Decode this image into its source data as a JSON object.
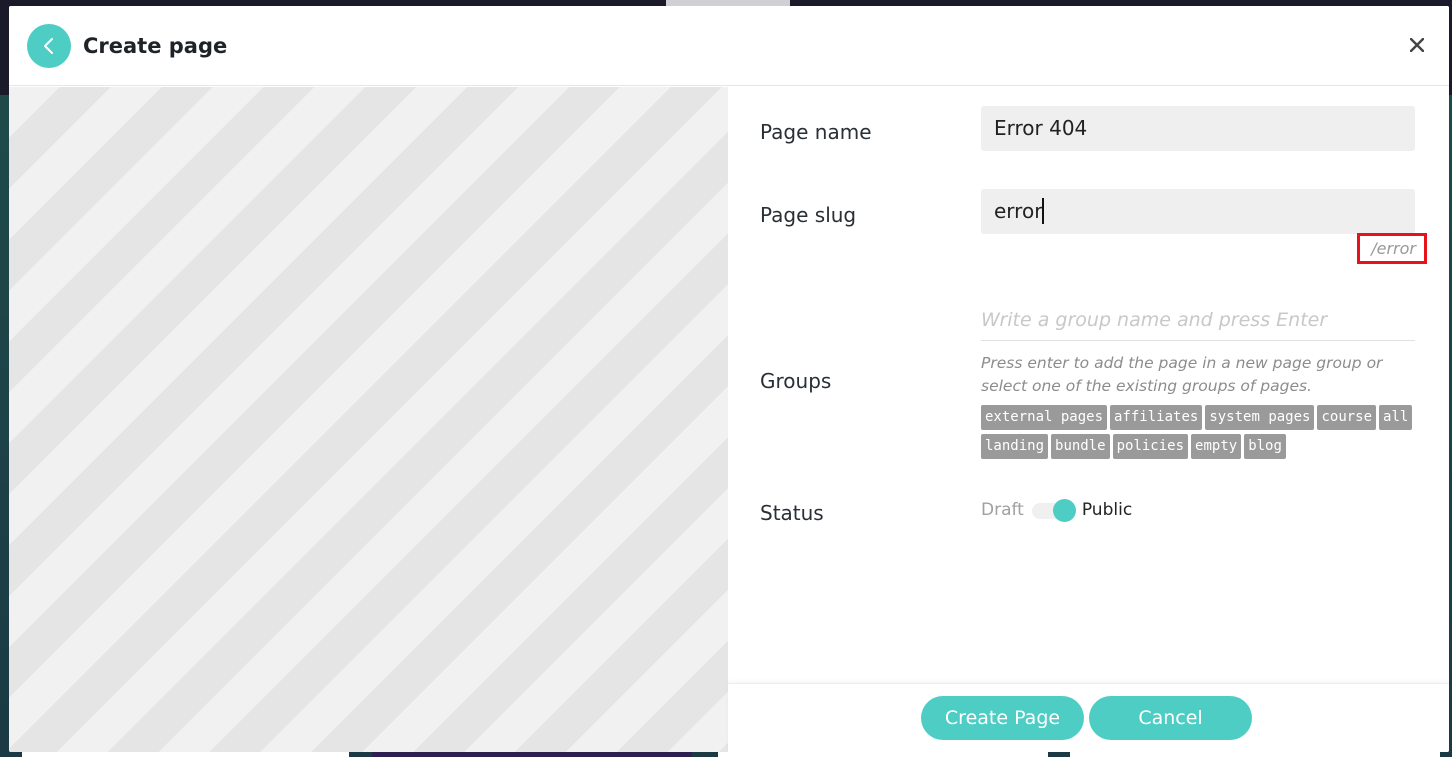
{
  "modal": {
    "title": "Create page"
  },
  "form": {
    "page_name": {
      "label": "Page name",
      "value": "Error 404"
    },
    "page_slug": {
      "label": "Page slug",
      "value": "error",
      "hint": "/error"
    },
    "groups": {
      "label": "Groups",
      "placeholder": "Write a group name and press Enter",
      "help": "Press enter to add the page in a new page group or select one of the existing groups of pages.",
      "tags": [
        "external pages",
        "affiliates",
        "system pages",
        "course",
        "all",
        "landing",
        "bundle",
        "policies",
        "empty",
        "blog"
      ]
    },
    "status": {
      "label": "Status",
      "off_label": "Draft",
      "on_label": "Public",
      "value": "Public"
    }
  },
  "footer": {
    "create_label": "Create Page",
    "cancel_label": "Cancel"
  },
  "colors": {
    "accent": "#4ecdc4",
    "tag_bg": "#9a9a9a",
    "highlight": "#e8121b"
  }
}
